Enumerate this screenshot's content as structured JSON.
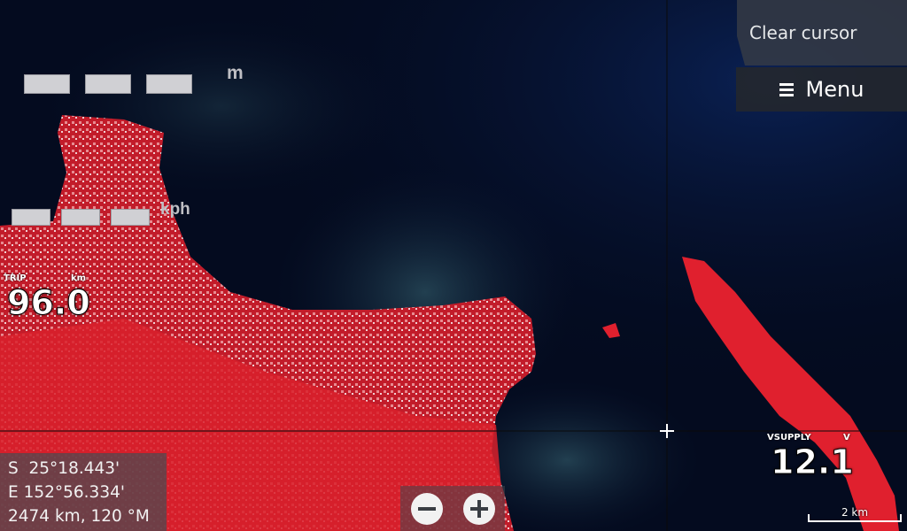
{
  "window": {
    "clear_cursor_label": "Clear cursor",
    "menu_label": "Menu"
  },
  "overlay": {
    "depth_unit": "m",
    "speed_unit": "kph"
  },
  "trip": {
    "label": "TRIP",
    "unit": "km",
    "value": "96.0"
  },
  "vsupply": {
    "label": "VSUPPLY",
    "unit": "V",
    "value": "12.1"
  },
  "cursor_position": {
    "lat": "S  25°18.443'",
    "lon": "E 152°56.334'",
    "range_bearing": "2474 km, 120 °M"
  },
  "scale": {
    "label": "2 km"
  },
  "colors": {
    "land": "#d9202c",
    "water": "#040b1f",
    "panel": "#373c46"
  },
  "icons": [
    "menu-icon",
    "zoom-out-icon",
    "zoom-in-icon",
    "cursor-crosshair-icon"
  ]
}
